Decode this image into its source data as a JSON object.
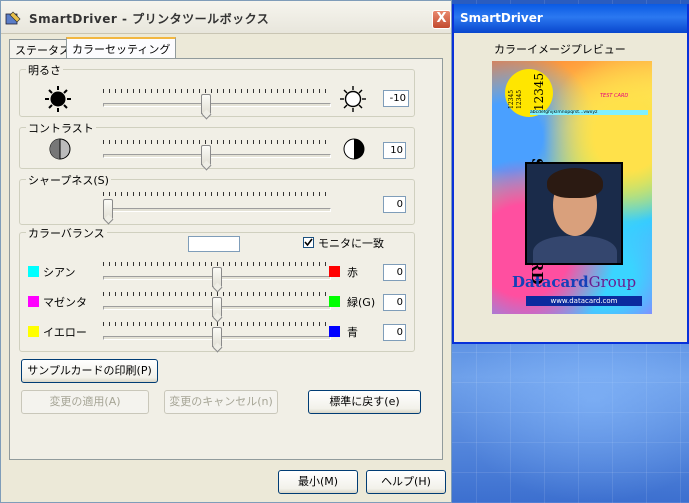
{
  "window": {
    "title": "SmartDriver - プリンタツールボックス",
    "close_label": "X",
    "tabs": [
      {
        "label": "ステータス",
        "active": false
      },
      {
        "label": "カラーセッティング",
        "active": true
      }
    ]
  },
  "brightness": {
    "label": "明るさ",
    "value": "-10",
    "level": 45
  },
  "contrast": {
    "label": "コントラスト",
    "value": "10",
    "level": 45
  },
  "sharpness": {
    "label": "シャープネス(S)",
    "value": "0",
    "level": 0
  },
  "color_balance": {
    "label": "カラーバランス",
    "match_monitor_label": "モニタに一致",
    "match_monitor_checked": true,
    "rows": [
      {
        "left_label": "シアン",
        "left_color": "#00ffff",
        "right_label": "赤",
        "right_color": "#ff0000",
        "value": "0",
        "level": 50
      },
      {
        "left_label": "マゼンタ",
        "left_color": "#ff00ff",
        "right_label": "緑(G)",
        "right_color": "#00ff00",
        "value": "0",
        "level": 50
      },
      {
        "left_label": "イエロー",
        "left_color": "#ffff00",
        "right_label": "青",
        "right_color": "#0000ff",
        "value": "0",
        "level": 50
      }
    ]
  },
  "buttons": {
    "print_sample": "サンプルカードの印刷(P)",
    "apply": "変更の適用(A)",
    "cancel_changes": "変更のキャンセル(n)",
    "reset_default": "標準に戻す(e)",
    "minimize": "最小(M)",
    "help": "ヘルプ(H)"
  },
  "preview": {
    "title": "SmartDriver",
    "heading": "カラーイメージプレビュー",
    "card": {
      "circle_number": "12345",
      "circle_small_1": "12345",
      "circle_small_2": "12345",
      "test_card": "TEST CARD",
      "alphabet": "abcdefghijklmnopqrst...vwxyz",
      "side_text": "SAMPLE CARD",
      "brand_1": "Datacard",
      "brand_2": "Group",
      "url": "www.datacard.com"
    }
  }
}
